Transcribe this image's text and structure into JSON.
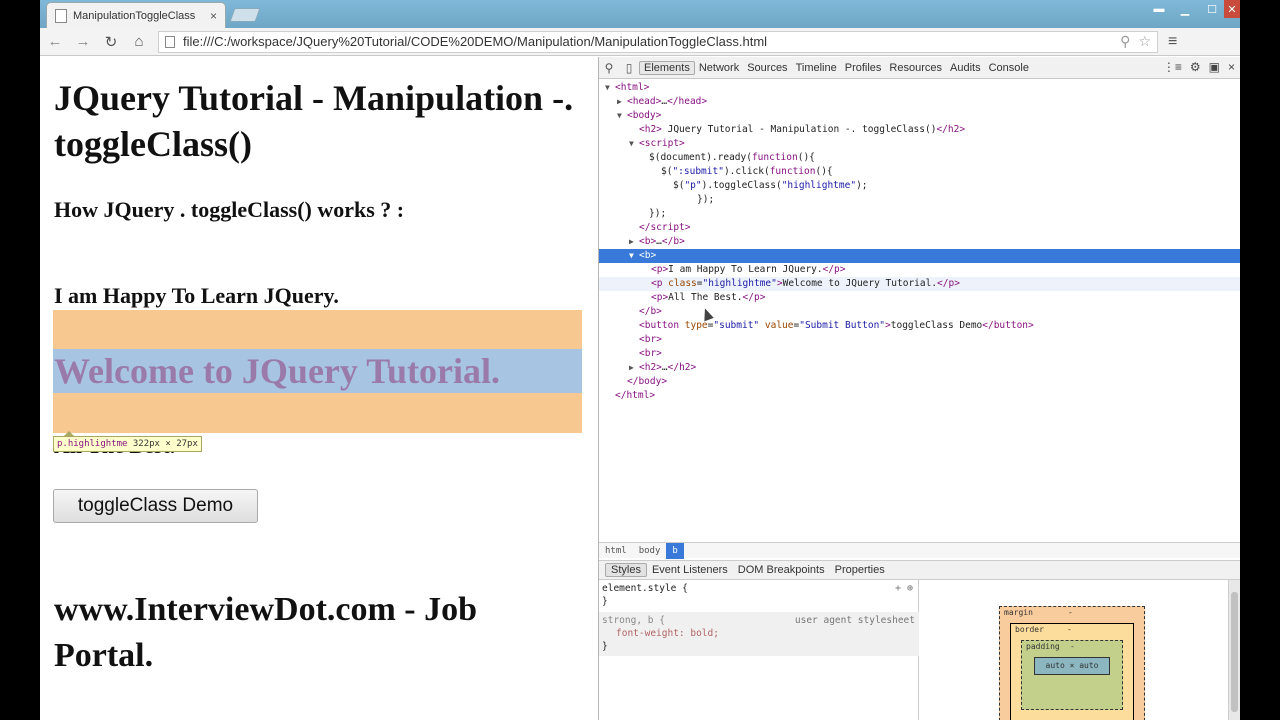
{
  "browser": {
    "tab_title": "ManipulationToggleClass",
    "tab_close": "×",
    "url": "file:///C:/workspace/JQuery%20Tutorial/CODE%20DEMO/Manipulation/ManipulationToggleClass.html",
    "icons": {
      "back": "←",
      "forward": "→",
      "reload": "↻",
      "home": "⌂",
      "zoom": "⚲",
      "star": "☆",
      "menu": "≡",
      "win_user": "▬",
      "win_min": "▁",
      "win_max": "☐",
      "win_close": "✕"
    }
  },
  "page": {
    "heading": "JQuery Tutorial - Manipulation -. toggleClass()",
    "subheading": "How JQuery . toggleClass() works ? :",
    "para1": "I am Happy To Learn JQuery.",
    "para2": "Welcome to JQuery Tutorial.",
    "para3": "All The Best.",
    "button_label": "toggleClass Demo",
    "footer_heading": "www.InterviewDot.com - Job Portal.",
    "tooltip_selector": "p.highlightme",
    "tooltip_size": "322px × 27px",
    "colors": {
      "highlight_margin": "#f7c88f",
      "highlight_content": "#a7c4e3",
      "highlight_text": "#9a7aa8"
    }
  },
  "devtools": {
    "tabs": [
      "Elements",
      "Network",
      "Sources",
      "Timeline",
      "Profiles",
      "Resources",
      "Audits",
      "Console"
    ],
    "active_tab": "Elements",
    "icons": {
      "search": "⚲",
      "device": "▯",
      "drawer": "⋮≡",
      "settings": "⚙",
      "dock": "▣",
      "close": "×"
    },
    "breadcrumbs": [
      "html",
      "body",
      "b"
    ],
    "sidebar_tabs": [
      "Styles",
      "Event Listeners",
      "DOM Breakpoints",
      "Properties"
    ],
    "styles": {
      "element_style": "element.style {",
      "close_brace": "}",
      "add_icons": "+ ⊕",
      "ua_selector": "strong, b {",
      "ua_source": "user agent stylesheet",
      "ua_prop": "font-weight: bold;"
    },
    "metrics": {
      "margin_label": "margin",
      "border_label": "border",
      "padding_label": "padding",
      "content": "auto × auto",
      "dash": "-"
    }
  }
}
